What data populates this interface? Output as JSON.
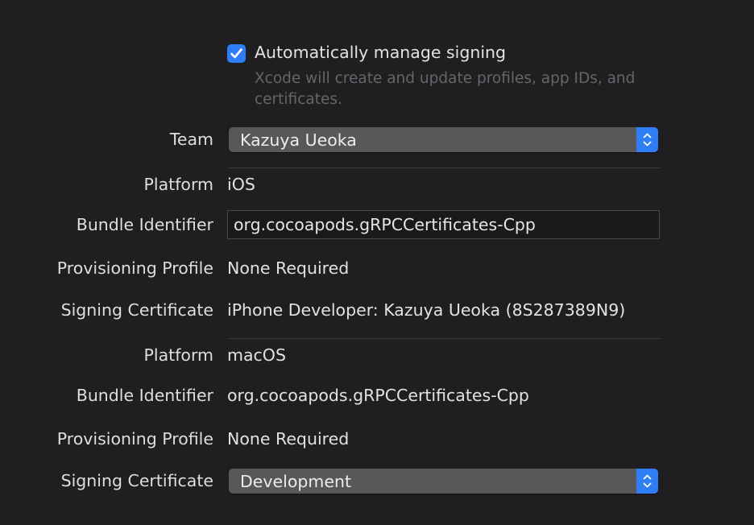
{
  "signing": {
    "checkbox_checked": true,
    "checkbox_label": "Automatically manage signing",
    "checkbox_description": "Xcode will create and update profiles, app IDs, and certificates."
  },
  "team": {
    "label": "Team",
    "value": "Kazuya Ueoka"
  },
  "ios": {
    "platform_label": "Platform",
    "platform_value": "iOS",
    "bundle_label": "Bundle Identifier",
    "bundle_value": "org.cocoapods.gRPCCertificates-Cpp",
    "profile_label": "Provisioning Profile",
    "profile_value": "None Required",
    "certificate_label": "Signing Certificate",
    "certificate_value": "iPhone Developer: Kazuya Ueoka (8S287389N9)"
  },
  "macos": {
    "platform_label": "Platform",
    "platform_value": "macOS",
    "bundle_label": "Bundle Identifier",
    "bundle_value": "org.cocoapods.gRPCCertificates-Cpp",
    "profile_label": "Provisioning Profile",
    "profile_value": "None Required",
    "certificate_label": "Signing Certificate",
    "certificate_value": "Development"
  },
  "colors": {
    "background": "#1f1f21",
    "accent": "#2f7ef5",
    "popup": "#58585b",
    "secondary_text": "#66666a"
  },
  "icons": {
    "checkbox": "checkmark-icon",
    "popup": "updown-chevron-icon"
  }
}
